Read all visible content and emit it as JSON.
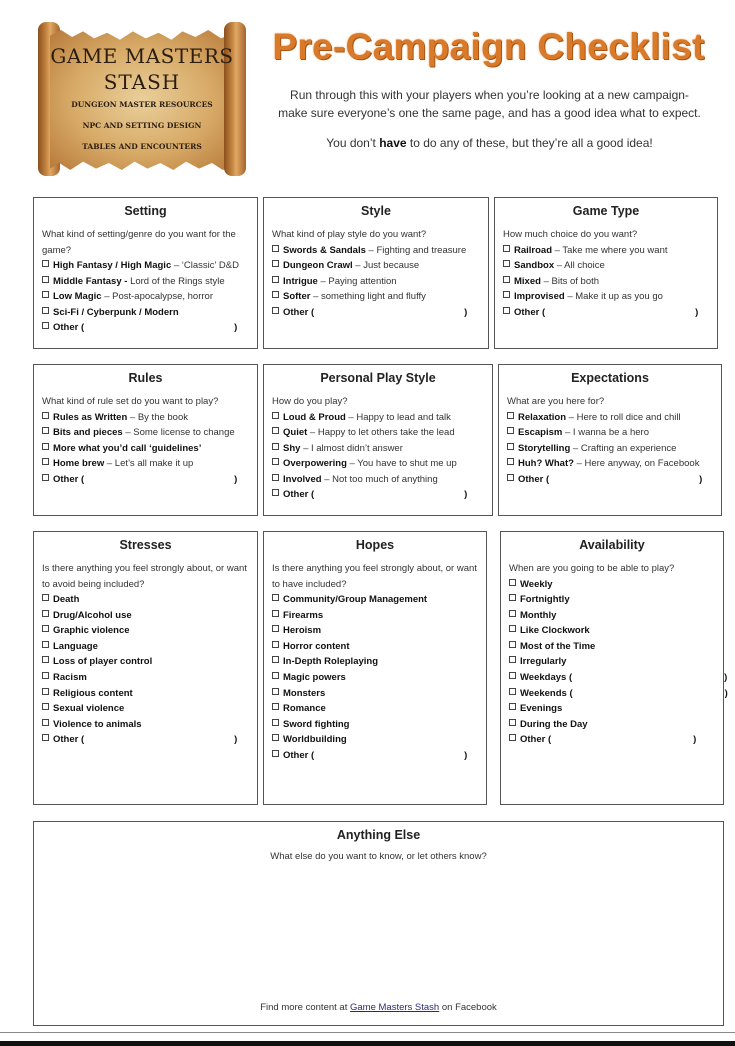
{
  "logo": {
    "title_line1": "GAME MASTERS",
    "title_line2": "STASH",
    "subtitles": [
      "DUNGEON MASTER RESOURCES",
      "NPC AND SETTING DESIGN",
      "TABLES AND ENCOUNTERS"
    ]
  },
  "header": {
    "title": "Pre-Campaign Checklist",
    "intro_line1": "Run through this with your players when you’re looking at a new campaign-",
    "intro_line2": "make sure everyone’s one the same page, and has a good idea what to expect.",
    "note_before": "You don’t ",
    "note_bold": "have",
    "note_after": " to do any of these, but they’re all a good idea!"
  },
  "colors": {
    "title": "#d9792a",
    "border": "#555555",
    "link": "#2a2a7a"
  },
  "sections": {
    "setting": {
      "title": "Setting",
      "question": "What kind of setting/genre do you want for the game?",
      "items": [
        {
          "bold": "High Fantasy / High Magic",
          "desc": " – ‘Classic’ D&D"
        },
        {
          "bold": "Middle Fantasy -",
          "desc": " Lord of the Rings style"
        },
        {
          "bold": "Low Magic",
          "desc": " – Post-apocalypse, horror"
        },
        {
          "bold": "Sci-Fi / Cyberpunk / Modern",
          "desc": ""
        },
        {
          "bold": "Other (",
          "desc": "",
          "close": ")"
        }
      ]
    },
    "style": {
      "title": "Style",
      "question": "What kind of play style do you want?",
      "items": [
        {
          "bold": "Swords & Sandals",
          "desc": " – Fighting and treasure"
        },
        {
          "bold": "Dungeon Crawl",
          "desc": " – Just because"
        },
        {
          "bold": "Intrigue",
          "desc": " – Paying attention"
        },
        {
          "bold": "Softer",
          "desc": " – something light and fluffy"
        },
        {
          "bold": "Other (",
          "desc": "",
          "close": ")"
        }
      ]
    },
    "game_type": {
      "title": "Game Type",
      "question": "How much choice do you want?",
      "items": [
        {
          "bold": "Railroad",
          "desc": " – Take me where you want"
        },
        {
          "bold": "Sandbox",
          "desc": " – All choice"
        },
        {
          "bold": "Mixed",
          "desc": " – Bits of both"
        },
        {
          "bold": "Improvised",
          "desc": " – Make it up as you go"
        },
        {
          "bold": "Other (",
          "desc": "",
          "close": ")"
        }
      ]
    },
    "rules": {
      "title": "Rules",
      "question": "What kind of rule set do you want to play?",
      "items": [
        {
          "bold": "Rules as Written",
          "desc": " – By the book"
        },
        {
          "bold": "Bits and pieces",
          "desc": " – Some license to change"
        },
        {
          "bold": "More what you’d call ‘guidelines’",
          "desc": ""
        },
        {
          "bold": "Home brew",
          "desc": " – Let’s all make it up"
        },
        {
          "bold": "Other (",
          "desc": "",
          "close": ")"
        }
      ]
    },
    "personal_play_style": {
      "title": "Personal Play Style",
      "question": "How do you play?",
      "items": [
        {
          "bold": "Loud & Proud",
          "desc": " – Happy to lead and talk"
        },
        {
          "bold": "Quiet",
          "desc": " – Happy to let others take the lead"
        },
        {
          "bold": "Shy",
          "desc": " – I almost didn’t answer"
        },
        {
          "bold": "Overpowering",
          "desc": " – You have to shut me up"
        },
        {
          "bold": "Involved",
          "desc": " – Not too much of anything"
        },
        {
          "bold": "Other (",
          "desc": "",
          "close": ")"
        }
      ]
    },
    "expectations": {
      "title": "Expectations",
      "question": "What are you here for?",
      "items": [
        {
          "bold": "Relaxation",
          "desc": " – Here to roll dice and chill"
        },
        {
          "bold": "Escapism",
          "desc": " – I wanna be a hero"
        },
        {
          "bold": "Storytelling",
          "desc": " – Crafting an experience"
        },
        {
          "bold": "Huh? What?",
          "desc": " – Here anyway, on Facebook"
        },
        {
          "bold": "Other (",
          "desc": "",
          "close": ")"
        }
      ]
    },
    "stresses": {
      "title": "Stresses",
      "question": "Is there anything you feel strongly about, or want to avoid being included?",
      "items": [
        {
          "bold": "Death"
        },
        {
          "bold": "Drug/Alcohol use"
        },
        {
          "bold": "Graphic violence"
        },
        {
          "bold": "Language"
        },
        {
          "bold": "Loss of player control"
        },
        {
          "bold": "Racism"
        },
        {
          "bold": "Religious content"
        },
        {
          "bold": "Sexual violence"
        },
        {
          "bold": "Violence to animals"
        },
        {
          "bold": "Other (",
          "close": ")"
        }
      ]
    },
    "hopes": {
      "title": "Hopes",
      "question": "Is there anything you feel strongly about, or want to have included?",
      "items": [
        {
          "bold": "Community/Group Management"
        },
        {
          "bold": "Firearms"
        },
        {
          "bold": "Heroism"
        },
        {
          "bold": "Horror content"
        },
        {
          "bold": "In-Depth Roleplaying"
        },
        {
          "bold": "Magic powers"
        },
        {
          "bold": "Monsters"
        },
        {
          "bold": "Romance"
        },
        {
          "bold": "Sword fighting"
        },
        {
          "bold": "Worldbuilding"
        },
        {
          "bold": "Other (",
          "close": ")"
        }
      ]
    },
    "availability": {
      "title": "Availability",
      "question": "When are you going to be able to play?",
      "items": [
        {
          "bold": "Weekly"
        },
        {
          "bold": "Fortnightly"
        },
        {
          "bold": "Monthly"
        },
        {
          "bold": "Like Clockwork"
        },
        {
          "bold": "Most of the Time"
        },
        {
          "bold": "Irregularly"
        },
        {
          "bold": "Weekdays (",
          "close": ")"
        },
        {
          "bold": "Weekends (",
          "close": ")"
        },
        {
          "bold": "Evenings"
        },
        {
          "bold": "During the Day"
        },
        {
          "bold": "Other (",
          "close": ")"
        }
      ]
    },
    "anything_else": {
      "title": "Anything Else",
      "question": "What else do you want to know, or let others know?"
    }
  },
  "footer": {
    "before": "Find more content at ",
    "link": "Game Masters Stash",
    "after": " on Facebook"
  }
}
